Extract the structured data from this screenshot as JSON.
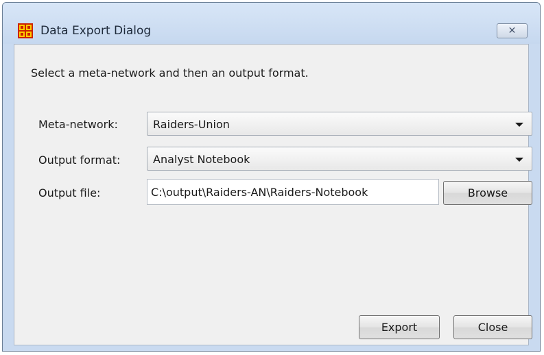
{
  "window": {
    "title": "Data Export Dialog",
    "close_glyph": "✕",
    "app_icon": "network-grid-icon"
  },
  "instructions": "Select a meta-network and then an output format.",
  "form": {
    "meta_network": {
      "label": "Meta-network:",
      "value": "Raiders-Union"
    },
    "output_format": {
      "label": "Output format:",
      "value": "Analyst Notebook"
    },
    "output_file": {
      "label": "Output file:",
      "value": "C:\\output\\Raiders-AN\\Raiders-Notebook",
      "browse_label": "Browse"
    }
  },
  "buttons": {
    "export_label": "Export",
    "close_label": "Close"
  },
  "colors": {
    "frame": "#c9daf0",
    "client": "#f0f0f0",
    "icon_fill": "#ffcc00",
    "icon_stroke": "#cc2200"
  }
}
